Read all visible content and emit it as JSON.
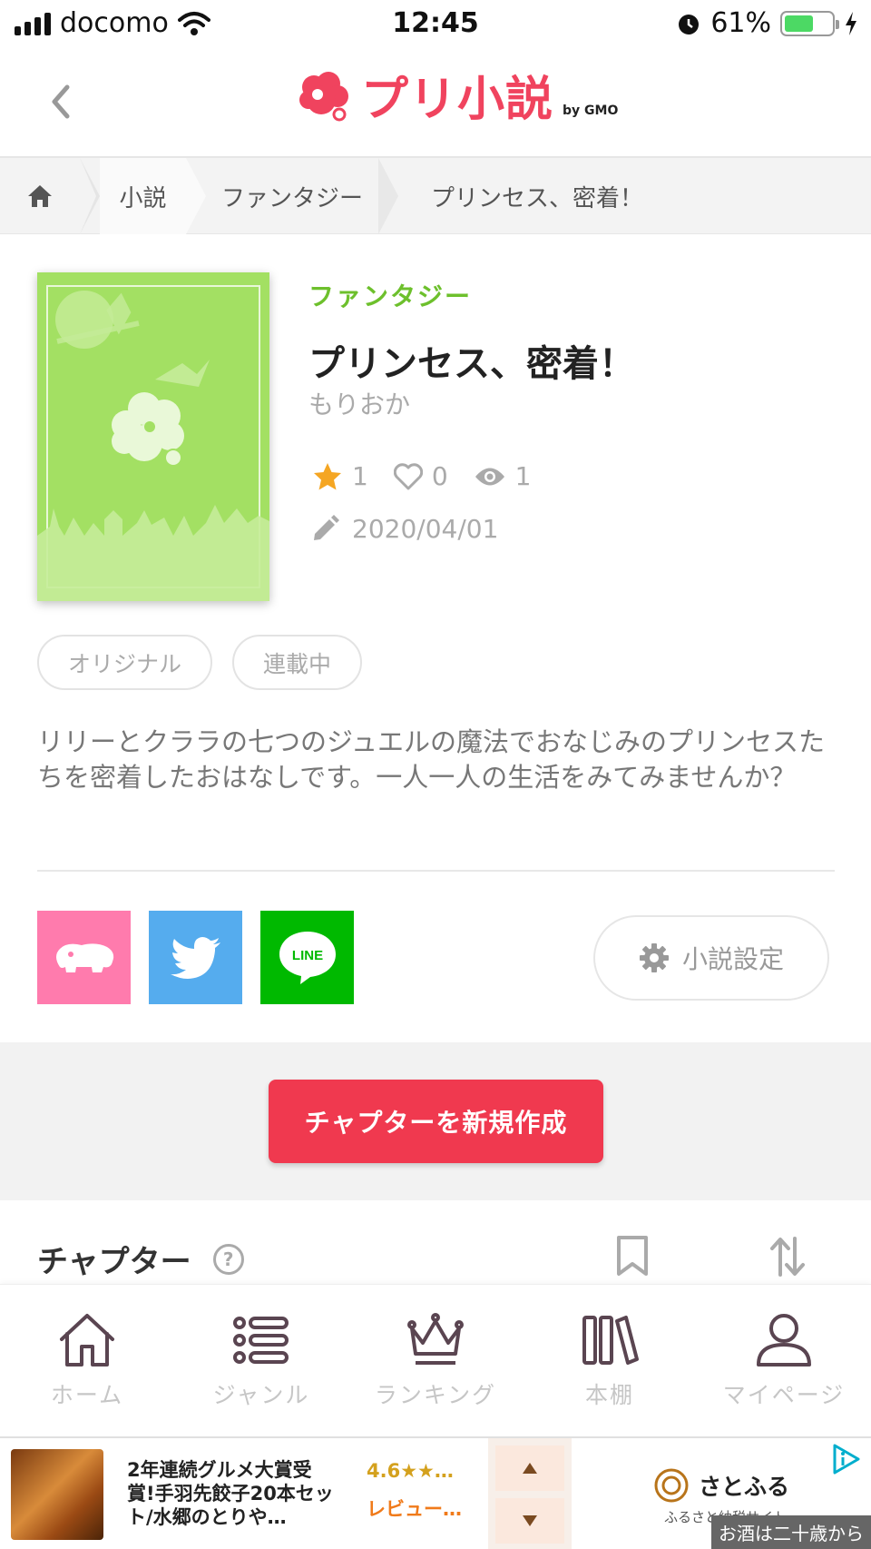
{
  "status": {
    "carrier": "docomo",
    "time": "12:45",
    "battery": "61%",
    "battery_level": 0.61
  },
  "header": {
    "logo": "プリ小説",
    "logo_by": "by GMO"
  },
  "breadcrumb": {
    "items": [
      "小説",
      "ファンタジー",
      "プリンセス、密着！"
    ]
  },
  "book": {
    "genre": "ファンタジー",
    "title": "プリンセス、密着！",
    "author": "もりおか",
    "stars": "1",
    "likes": "0",
    "views": "1",
    "updated": "2020/04/01",
    "tags": [
      "オリジナル",
      "連載中"
    ],
    "description": "リリーとクララの七つのジュエルの魔法でおなじみのプリンセスたちを密着したおはなしです。一人一人の生活をみてみませんか？"
  },
  "share": {
    "line_label": "LINE"
  },
  "settings_label": "小説設定",
  "cta_label": "チャプターを新規作成",
  "chapter": {
    "heading": "チャプター",
    "help": "?"
  },
  "tabs": [
    {
      "label": "ホーム",
      "icon": "home-icon"
    },
    {
      "label": "ジャンル",
      "icon": "list-icon"
    },
    {
      "label": "ランキング",
      "icon": "crown-icon"
    },
    {
      "label": "本棚",
      "icon": "bookshelf-icon"
    },
    {
      "label": "マイページ",
      "icon": "user-icon"
    }
  ],
  "ad": {
    "text": "2年連続グルメ大賞受賞!手羽先餃子20本セット/水郷のとりや…",
    "rating": "4.6★★…",
    "review": "レビュー…",
    "brand": "さとふる",
    "brand_sub": "ふるさと納税サイト",
    "note": "お酒は二十歳から"
  },
  "colors": {
    "brand": "#f0435e",
    "genre": "#6dc02c",
    "cta": "#f0394f",
    "cover": "#a3e063"
  }
}
